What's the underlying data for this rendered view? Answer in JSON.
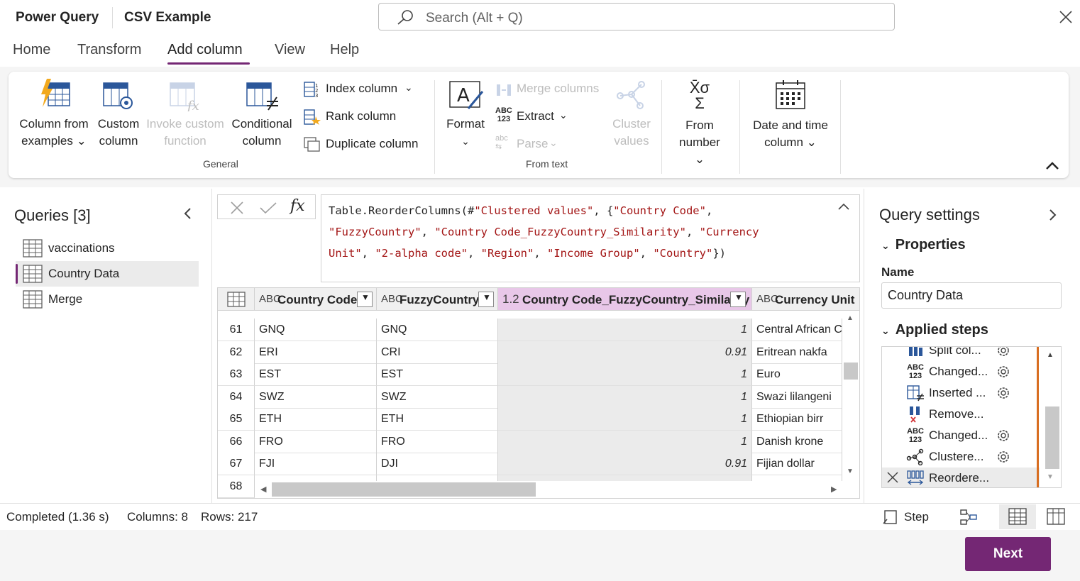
{
  "app": {
    "name": "Power Query",
    "document": "CSV Example"
  },
  "search": {
    "placeholder": "Search (Alt + Q)"
  },
  "tabs": [
    "Home",
    "Transform",
    "Add column",
    "View",
    "Help"
  ],
  "active_tab": "Add column",
  "ribbon": {
    "column_from_examples": [
      "Column from",
      "examples"
    ],
    "custom_column": [
      "Custom",
      "column"
    ],
    "invoke_custom_function": [
      "Invoke custom",
      "function"
    ],
    "conditional_column": [
      "Conditional",
      "column"
    ],
    "index_column": "Index column",
    "rank_column": "Rank column",
    "duplicate_column": "Duplicate column",
    "general_group": "General",
    "format": "Format",
    "merge_columns": "Merge columns",
    "extract": "Extract",
    "parse": "Parse",
    "from_text_group": "From text",
    "cluster_values": [
      "Cluster",
      "values"
    ],
    "from_number": [
      "From",
      "number"
    ],
    "date_time_column": [
      "Date and time",
      "column"
    ]
  },
  "queries": {
    "title": "Queries [3]",
    "items": [
      "vaccinations",
      "Country Data",
      "Merge"
    ],
    "selected": "Country Data"
  },
  "formula": {
    "fx": "fx",
    "segments": [
      {
        "t": "Table.ReorderColumns(#",
        "s": false
      },
      {
        "t": "\"Clustered values\"",
        "s": true
      },
      {
        "t": ", {",
        "s": false
      },
      {
        "t": "\"Country Code\"",
        "s": true
      },
      {
        "t": ",\n",
        "s": false
      },
      {
        "t": "\"FuzzyCountry\"",
        "s": true
      },
      {
        "t": ", ",
        "s": false
      },
      {
        "t": "\"Country Code_FuzzyCountry_Similarity\"",
        "s": true
      },
      {
        "t": ", ",
        "s": false
      },
      {
        "t": "\"Currency\nUnit\"",
        "s": true
      },
      {
        "t": ", ",
        "s": false
      },
      {
        "t": "\"2-alpha code\"",
        "s": true
      },
      {
        "t": ", ",
        "s": false
      },
      {
        "t": "\"Region\"",
        "s": true
      },
      {
        "t": ", ",
        "s": false
      },
      {
        "t": "\"Income Group\"",
        "s": true
      },
      {
        "t": ", ",
        "s": false
      },
      {
        "t": "\"Country\"",
        "s": true
      },
      {
        "t": "})",
        "s": false
      }
    ]
  },
  "grid": {
    "columns": [
      {
        "type": "ABC",
        "label": "Country Code"
      },
      {
        "type": "ABC",
        "label": "FuzzyCountry"
      },
      {
        "type": "1.2",
        "label": "Country Code_FuzzyCountry_Similarity"
      },
      {
        "type": "ABC",
        "label": "Currency Unit"
      }
    ],
    "rows": [
      {
        "n": "61",
        "code": "GNQ",
        "fuzzy": "GNQ",
        "sim": "1",
        "cur": "Central African C"
      },
      {
        "n": "62",
        "code": "ERI",
        "fuzzy": "CRI",
        "sim": "0.91",
        "cur": "Eritrean nakfa"
      },
      {
        "n": "63",
        "code": "EST",
        "fuzzy": "EST",
        "sim": "1",
        "cur": "Euro"
      },
      {
        "n": "64",
        "code": "SWZ",
        "fuzzy": "SWZ",
        "sim": "1",
        "cur": "Swazi lilangeni"
      },
      {
        "n": "65",
        "code": "ETH",
        "fuzzy": "ETH",
        "sim": "1",
        "cur": "Ethiopian birr"
      },
      {
        "n": "66",
        "code": "FRO",
        "fuzzy": "FRO",
        "sim": "1",
        "cur": "Danish krone"
      },
      {
        "n": "67",
        "code": "FJI",
        "fuzzy": "DJI",
        "sim": "0.91",
        "cur": "Fijian dollar"
      },
      {
        "n": "68",
        "code": "",
        "fuzzy": "",
        "sim": "",
        "cur": ""
      }
    ]
  },
  "query_settings": {
    "title": "Query settings",
    "properties": "Properties",
    "name_label": "Name",
    "name_value": "Country Data",
    "applied_steps": "Applied steps",
    "steps": [
      {
        "label": "Split col...",
        "icon": "split-column-icon",
        "gear": true
      },
      {
        "label": "Changed...",
        "icon": "abc123-icon",
        "gear": true
      },
      {
        "label": "Inserted ...",
        "icon": "conditional-column-icon",
        "gear": true
      },
      {
        "label": "Remove...",
        "icon": "remove-columns-icon",
        "gear": false
      },
      {
        "label": "Changed...",
        "icon": "abc123-icon",
        "gear": true
      },
      {
        "label": "Clustere...",
        "icon": "cluster-icon",
        "gear": true
      },
      {
        "label": "Reordere...",
        "icon": "reorder-icon",
        "gear": false
      }
    ]
  },
  "status": {
    "completed": "Completed (1.36 s)",
    "columns": "Columns: 8",
    "rows": "Rows: 217",
    "step": "Step"
  },
  "next_button": "Next",
  "colors": {
    "accent": "#742774",
    "step_rail": "#d86e21",
    "string": "#a31515"
  }
}
